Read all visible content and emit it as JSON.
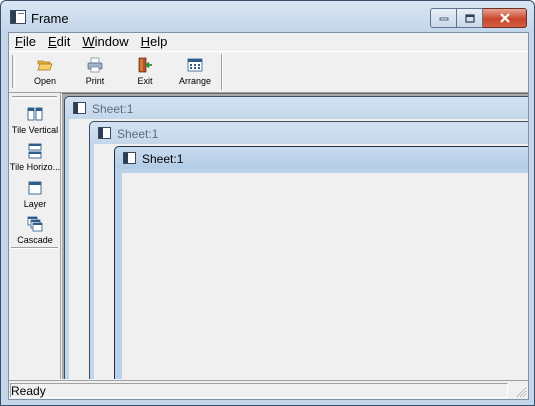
{
  "window": {
    "title": "Frame"
  },
  "menu": {
    "items": [
      {
        "label": "File",
        "u": "F",
        "rest": "ile"
      },
      {
        "label": "Edit",
        "u": "E",
        "rest": "dit"
      },
      {
        "label": "Window",
        "u": "W",
        "rest": "indow"
      },
      {
        "label": "Help",
        "u": "H",
        "rest": "elp"
      }
    ]
  },
  "toolbar": {
    "open_label": "Open",
    "print_label": "Print",
    "exit_label": "Exit",
    "arrange_label": "Arrange"
  },
  "sidebar": {
    "tile_vertical_label": "Tile Vertical",
    "tile_horizontal_label": "Tile Horizo...",
    "layer_label": "Layer",
    "cascade_label": "Cascade"
  },
  "children": [
    {
      "title": "Sheet:1"
    },
    {
      "title": "Sheet:1"
    },
    {
      "title": "Sheet:1"
    }
  ],
  "status": {
    "text": "Ready"
  },
  "colors": {
    "frame_blue": "#c4d7ea",
    "close_red": "#c9462c",
    "mdi_gray": "#a9a9a9"
  }
}
